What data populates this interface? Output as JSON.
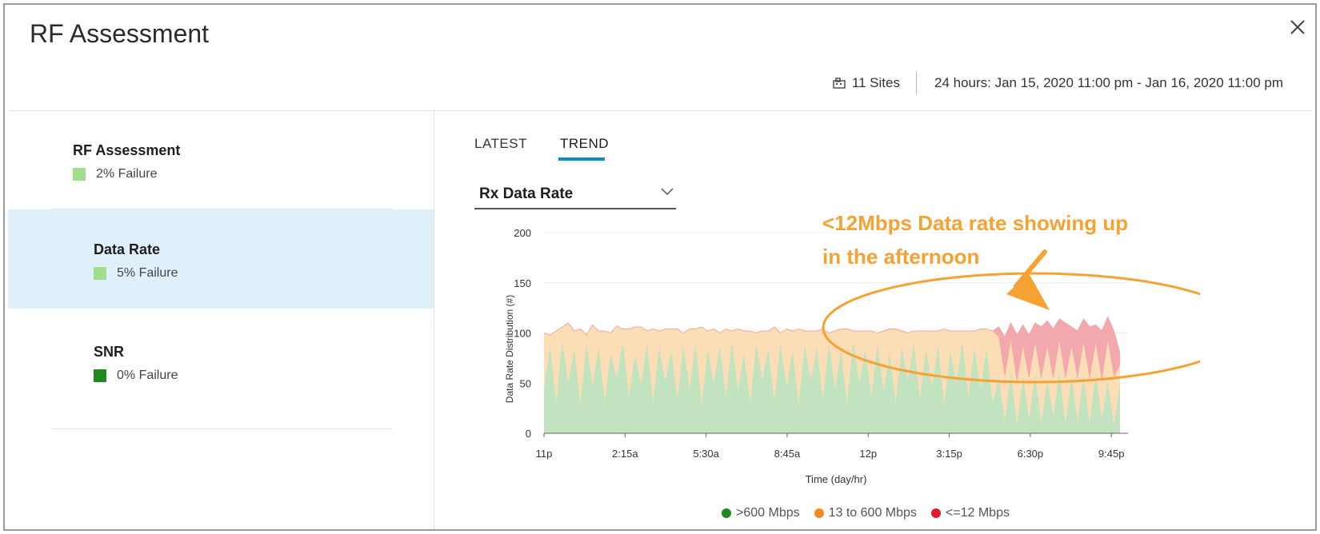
{
  "window": {
    "title": "RF Assessment"
  },
  "header": {
    "sites_label": "11 Sites",
    "time_range": "24 hours: Jan 15, 2020 11:00 pm - Jan 16, 2020 11:00 pm"
  },
  "sidebar": {
    "items": [
      {
        "name": "RF Assessment",
        "failure": "2% Failure",
        "swatch": "#9fdf8c",
        "active": false
      },
      {
        "name": "Data Rate",
        "failure": "5% Failure",
        "swatch": "#9fdf8c",
        "active": true
      },
      {
        "name": "SNR",
        "failure": "0% Failure",
        "swatch": "#1f8a1f",
        "active": false
      }
    ]
  },
  "tabs": [
    {
      "label": "LATEST",
      "active": false
    },
    {
      "label": "TREND",
      "active": true
    }
  ],
  "dropdown": {
    "selected": "Rx Data Rate"
  },
  "annotation": {
    "line1": "<12Mbps Data rate showing up",
    "line2": "in the afternoon",
    "color": "#f5a233"
  },
  "chart_data": {
    "type": "area",
    "ylabel": "Data Rate Distribution (#)",
    "xlabel": "Time (day/hr)",
    "ylim": [
      0,
      200
    ],
    "yticks": [
      0,
      50,
      100,
      150,
      200
    ],
    "xticks": [
      "11p",
      "2:15a",
      "5:30a",
      "8:45a",
      "12p",
      "3:15p",
      "6:30p",
      "9:45p"
    ],
    "grid": true,
    "legend_placement": "bottom",
    "series": [
      {
        "name": ">600 Mbps",
        "color": "#1e8a1e",
        "fill": "#c2e3bf"
      },
      {
        "name": "13 to 600 Mbps",
        "color": "#f08a1c",
        "fill": "#fbddb6"
      },
      {
        "name": "<=12 Mbps",
        "color": "#e01b2c",
        "fill": "#f2a8ad"
      }
    ],
    "x": [
      0,
      1,
      2,
      3,
      4,
      5,
      6,
      7,
      8,
      9,
      10,
      11,
      12,
      13,
      14,
      15,
      16,
      17,
      18,
      19,
      20,
      21,
      22,
      23,
      24,
      25,
      26,
      27,
      28,
      29,
      30,
      31,
      32,
      33,
      34,
      35,
      36,
      37,
      38,
      39,
      40,
      41,
      42,
      43,
      44,
      45,
      46,
      47,
      48,
      49,
      50,
      51,
      52,
      53,
      54,
      55,
      56,
      57,
      58,
      59,
      60,
      61,
      62,
      63,
      64,
      65,
      66,
      67,
      68,
      69,
      70,
      71,
      72,
      73,
      74,
      75,
      76,
      77,
      78,
      79,
      80,
      81,
      82,
      83,
      84,
      85,
      86,
      87,
      88,
      89,
      90,
      91,
      92,
      93,
      94,
      95
    ],
    "series_values": {
      ">600 Mbps": [
        42,
        88,
        30,
        92,
        50,
        84,
        28,
        90,
        46,
        86,
        32,
        80,
        55,
        92,
        36,
        78,
        48,
        90,
        30,
        86,
        52,
        82,
        34,
        88,
        44,
        90,
        28,
        84,
        50,
        86,
        36,
        92,
        42,
        80,
        30,
        88,
        54,
        84,
        32,
        90,
        46,
        82,
        28,
        88,
        52,
        86,
        34,
        90,
        44,
        82,
        30,
        92,
        50,
        84,
        36,
        88,
        42,
        80,
        30,
        86,
        52,
        90,
        34,
        84,
        46,
        88,
        28,
        82,
        50,
        92,
        36,
        86,
        44,
        84,
        30,
        56,
        12,
        62,
        8,
        58,
        14,
        60,
        10,
        54,
        16,
        62,
        8,
        58,
        12,
        56,
        10,
        60,
        14,
        52,
        8,
        50
      ],
      "13 to 600 Mbps": [
        58,
        10,
        72,
        14,
        60,
        18,
        76,
        8,
        62,
        16,
        70,
        20,
        52,
        12,
        68,
        28,
        58,
        12,
        74,
        16,
        52,
        22,
        70,
        12,
        60,
        14,
        78,
        18,
        54,
        14,
        68,
        10,
        62,
        22,
        72,
        12,
        48,
        18,
        74,
        10,
        58,
        20,
        76,
        14,
        50,
        16,
        70,
        10,
        58,
        22,
        74,
        10,
        52,
        18,
        66,
        12,
        60,
        24,
        74,
        16,
        48,
        12,
        68,
        18,
        56,
        14,
        76,
        20,
        52,
        10,
        66,
        16,
        60,
        20,
        72,
        40,
        44,
        30,
        42,
        28,
        40,
        30,
        44,
        32,
        38,
        30,
        46,
        28,
        42,
        34,
        44,
        30,
        38,
        40,
        48,
        18
      ],
      "<=12 Mbps": [
        0,
        0,
        0,
        0,
        0,
        0,
        0,
        0,
        0,
        0,
        0,
        0,
        0,
        0,
        0,
        0,
        0,
        0,
        0,
        0,
        0,
        0,
        0,
        0,
        0,
        0,
        0,
        0,
        0,
        0,
        0,
        0,
        0,
        0,
        0,
        0,
        0,
        0,
        0,
        0,
        0,
        0,
        0,
        0,
        0,
        0,
        0,
        0,
        0,
        0,
        0,
        0,
        0,
        0,
        0,
        0,
        0,
        0,
        0,
        0,
        0,
        0,
        0,
        0,
        0,
        0,
        0,
        0,
        0,
        0,
        0,
        0,
        0,
        0,
        0,
        10,
        40,
        18,
        48,
        22,
        44,
        20,
        52,
        26,
        50,
        22,
        56,
        20,
        48,
        24,
        52,
        18,
        50,
        24,
        46,
        12
      ]
    }
  }
}
